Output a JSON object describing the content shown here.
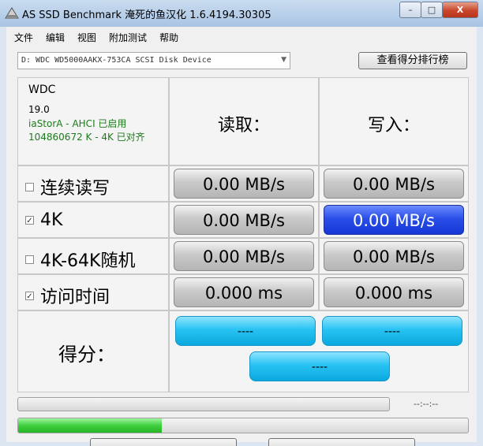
{
  "window": {
    "title": "AS SSD Benchmark 淹死的鱼汉化 1.6.4194.30305",
    "minimize_glyph": "–",
    "maximize_glyph": "□",
    "close_glyph": "X"
  },
  "menu": [
    "文件",
    "编辑",
    "视图",
    "附加测试",
    "帮助"
  ],
  "drive": {
    "selected": "D: WDC WD5000AAKX-753CA SCSI Disk Device",
    "arrow_icon": "chevron-down-icon"
  },
  "rank_button_label": "查看得分排行榜",
  "disk_info": {
    "model": "WDC",
    "firmware": "19.0",
    "driver": "iaStorA - AHCI 已启用",
    "alignment": "104860672 K - 4K 已对齐"
  },
  "columns": {
    "read": "读取：",
    "write": "写入："
  },
  "rows": [
    {
      "label": "连续读写",
      "checked": false,
      "read": "0.00 MB/s",
      "write": "0.00 MB/s"
    },
    {
      "label": "4K",
      "checked": true,
      "read": "0.00 MB/s",
      "write": "0.00 MB/s"
    },
    {
      "label": "4K-64K随机",
      "checked": false,
      "read": "0.00 MB/s",
      "write": "0.00 MB/s"
    },
    {
      "label": "访问时间",
      "checked": true,
      "read": "0.000 ms",
      "write": "0.000 ms"
    }
  ],
  "score": {
    "label": "得分：",
    "read": "----",
    "write": "----",
    "total": "----"
  },
  "status": {
    "elapsed": "--:--:--",
    "overall_progress": 0.32
  },
  "colors": {
    "active_value": "#2a4fe8",
    "score": "#28c3f3",
    "progress": "#3fcf3f",
    "info_text": "#1d7a1d"
  }
}
